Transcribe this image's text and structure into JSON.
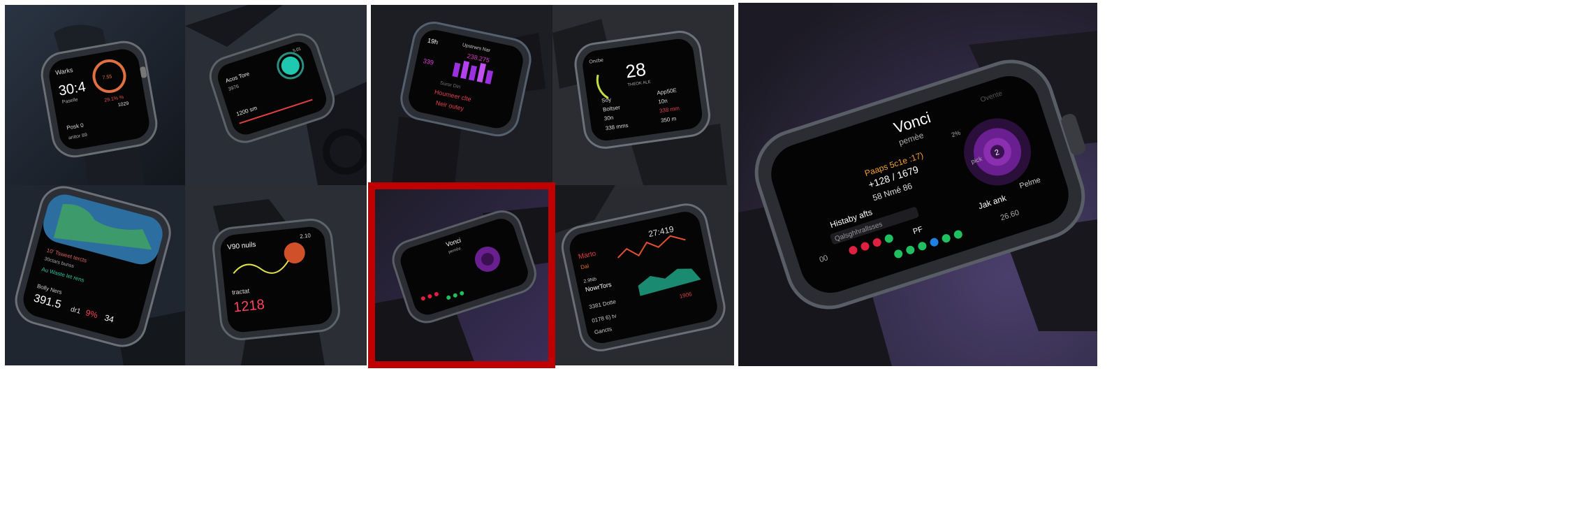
{
  "grid_left": {
    "tile_1": {
      "app": "Warks",
      "time": "30:4",
      "sub": "Paselle",
      "ring": "7.55",
      "stat_1": "29.1% %",
      "stat_2": "1029",
      "label": "Posk 0",
      "row": "anitor 89"
    },
    "tile_2": {
      "title": "Acos Tore",
      "pct": "3976",
      "value": "1200 sm",
      "corner": "5.01"
    },
    "tile_5": {
      "header": "10' Tsweet tercts",
      "sub": "30ctars bunss",
      "line": "Au Waste let rens",
      "footer": "Bolly Ners",
      "big": "391.5",
      "suffix": "dr1",
      "pct": "9%",
      "num": "34"
    },
    "tile_6": {
      "title": "V90 nuils",
      "time": "2.10",
      "label": "tractat",
      "big": "1218"
    }
  },
  "grid_right": {
    "tile_3": {
      "time": "19h",
      "header": "Upstrwrs Nar",
      "value": "238.275",
      "pct": "339",
      "line_1": "Suror Din",
      "line_2": "Houmeer clte",
      "line_3": "Neir outey"
    },
    "tile_4": {
      "title": "Oncbe",
      "big": "28",
      "sub": "THEOK ALE",
      "r1_l": "Soy",
      "r1_r": "App50E",
      "r2_l": "Boltser",
      "r2_r": "10n",
      "r3_l": "30n",
      "r3_r": "338 mm",
      "r4_l": "338 mms",
      "r4_r": "350 m"
    },
    "tile_7_selected": {
      "title": "Vonci",
      "sub": "pemèe"
    },
    "tile_8": {
      "time": "27:419",
      "title": "Marto",
      "sub": "Dal",
      "item_1": "2.9Nb",
      "item_2": "NowrTors",
      "item_3": "3381 Dotte",
      "item_4": "0178 6) tv",
      "item_5": "Gancts",
      "pct": "1906"
    }
  },
  "large_view": {
    "title": "Vonci",
    "subtitle": "pemèe",
    "top_right": "Ovente",
    "highlight": "Paaps 5c1e :17)",
    "line_1": "+128 / 1679",
    "line_2": "58 Nmé 86",
    "section": "Histaby afts",
    "search": "Qalsghhrallsses",
    "count": "00",
    "pf": "PF",
    "link": "Jak ank",
    "footer": "26.60",
    "dial_center": "2",
    "dial_label": "Pelme",
    "dial_side": "2%",
    "dial_left": "pick"
  },
  "colors": {
    "selection": "#c00000",
    "accent_purple": "#8a2fb0",
    "accent_orange": "#f0a030",
    "accent_red": "#ff3050"
  }
}
